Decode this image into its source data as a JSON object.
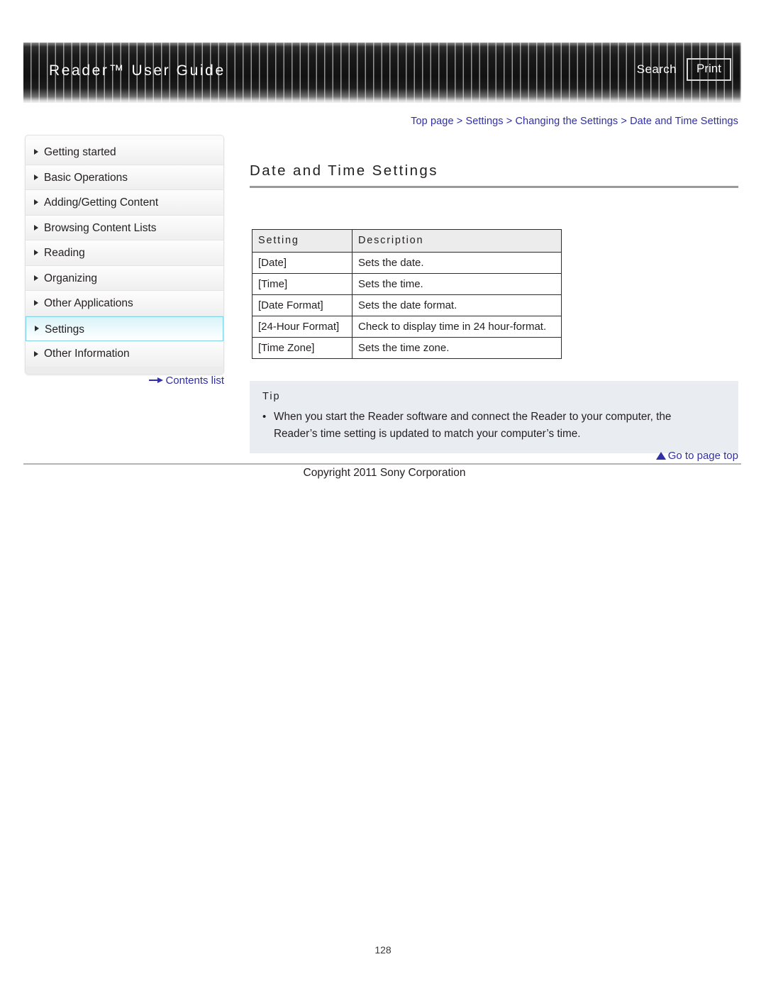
{
  "header": {
    "title": "Reader™ User Guide",
    "search_label": "Search",
    "print_label": "Print"
  },
  "breadcrumb": {
    "text": "Top page > Settings > Changing the Settings > Date and Time Settings"
  },
  "sidebar": {
    "items": [
      {
        "label": "Getting started",
        "active": false
      },
      {
        "label": "Basic Operations",
        "active": false
      },
      {
        "label": "Adding/Getting Content",
        "active": false
      },
      {
        "label": "Browsing Content Lists",
        "active": false
      },
      {
        "label": "Reading",
        "active": false
      },
      {
        "label": "Organizing",
        "active": false
      },
      {
        "label": "Other Applications",
        "active": false
      },
      {
        "label": "Settings",
        "active": true
      },
      {
        "label": "Other Information",
        "active": false
      }
    ],
    "contents_list_label": "Contents list"
  },
  "main": {
    "page_title": "Date and Time Settings",
    "table": {
      "headers": [
        "Setting",
        "Description"
      ],
      "rows": [
        [
          "[Date]",
          "Sets the date."
        ],
        [
          "[Time]",
          "Sets the time."
        ],
        [
          "[Date Format]",
          "Sets the date format."
        ],
        [
          "[24-Hour Format]",
          "Check to display time in 24 hour-format."
        ],
        [
          "[Time Zone]",
          "Sets the time zone."
        ]
      ]
    },
    "tip": {
      "label": "Tip",
      "bullet": "•",
      "text": "When you start the Reader software and connect the Reader to your computer, the Reader’s time setting is updated to match your computer’s time."
    },
    "go_to_top_label": "Go to page top"
  },
  "footer": {
    "copyright": "Copyright 2011 Sony Corporation",
    "page_number": "128"
  },
  "colors": {
    "link": "#2f2fa8",
    "header_bg": "#111111",
    "active_nav": "#d9f2f8",
    "tip_bg": "#e9edf2",
    "table_header_bg": "#ececec"
  }
}
